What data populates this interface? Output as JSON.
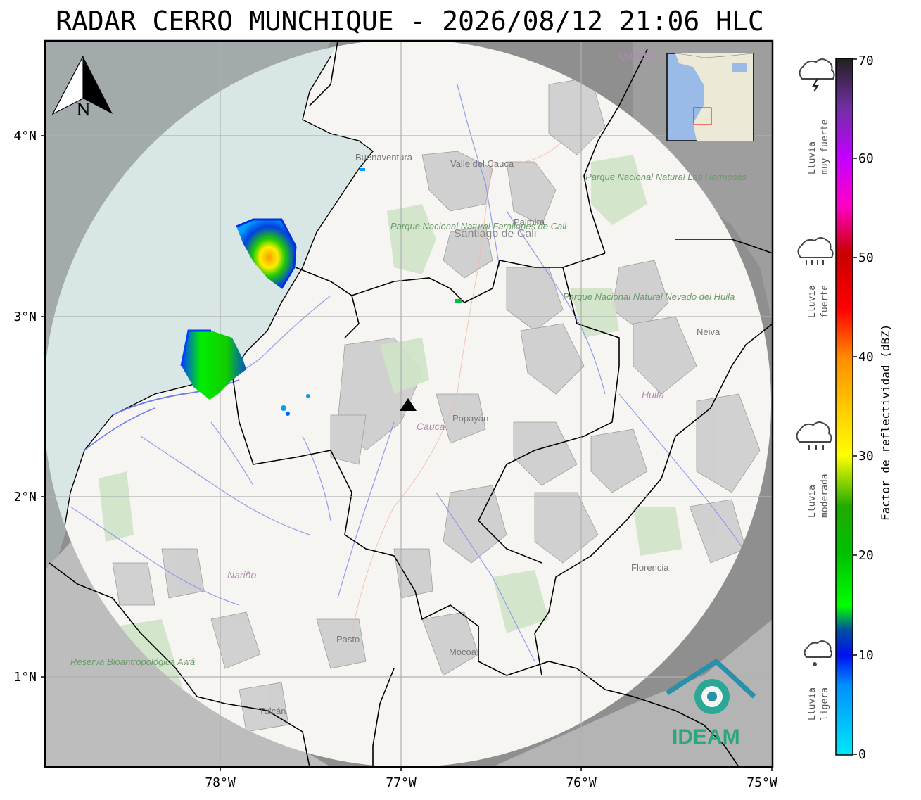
{
  "title": "RADAR CERRO MUNCHIQUE - 2026/08/12 21:06 HLC",
  "map": {
    "lat_ticks": [
      "4°N",
      "3°N",
      "2°N",
      "1°N"
    ],
    "lon_ticks": [
      "78°W",
      "77°W",
      "76°W",
      "75°W"
    ],
    "north_arrow_label": "N",
    "radar_site_icon": "triangle-marker-icon",
    "place_labels": {
      "buenaventura": "Buenaventura",
      "valle": "Valle del Cauca",
      "quindio": "Quindío",
      "palmira": "Palmira",
      "cali": "Santiago de Cali",
      "farallones": "Parque Nacional Natural Farallones de Cali",
      "hermosas": "Parque Nacional Natural Las Hermosas",
      "nevado": "Parque Nacional Natural Nevado del Huila",
      "neiva": "Neiva",
      "huila": "Huila",
      "popayan": "Popayán",
      "cauca": "Cauca",
      "narino": "Nariño",
      "pasto": "Pasto",
      "mocoa": "Mocoa",
      "florencia": "Florencia",
      "tulcan": "Tulcán",
      "reserva": "Reserva Bioantropológica Awá"
    },
    "logo_text": "IDEAM",
    "colors": {
      "ocean": "#d8e6e6",
      "land": "#f6f5f2",
      "outside_range": "#8a8a8a",
      "border": "#000000",
      "rivers": "#7a86f2"
    }
  },
  "colorbar": {
    "label": "Factor de reflectividad (dBZ)",
    "ticks": [
      "0",
      "10",
      "20",
      "30",
      "40",
      "50",
      "60",
      "70"
    ],
    "categories": [
      {
        "label1": "Lluvia",
        "label2": "muy fuerte",
        "icon": "cloud-lightning-icon"
      },
      {
        "label1": "Lluvia",
        "label2": "fuerte",
        "icon": "cloud-heavy-rain-icon"
      },
      {
        "label1": "Lluvia",
        "label2": "moderada",
        "icon": "cloud-rain-icon"
      },
      {
        "label1": "Lluvia",
        "label2": "ligera",
        "icon": "cloud-drizzle-icon"
      }
    ]
  }
}
